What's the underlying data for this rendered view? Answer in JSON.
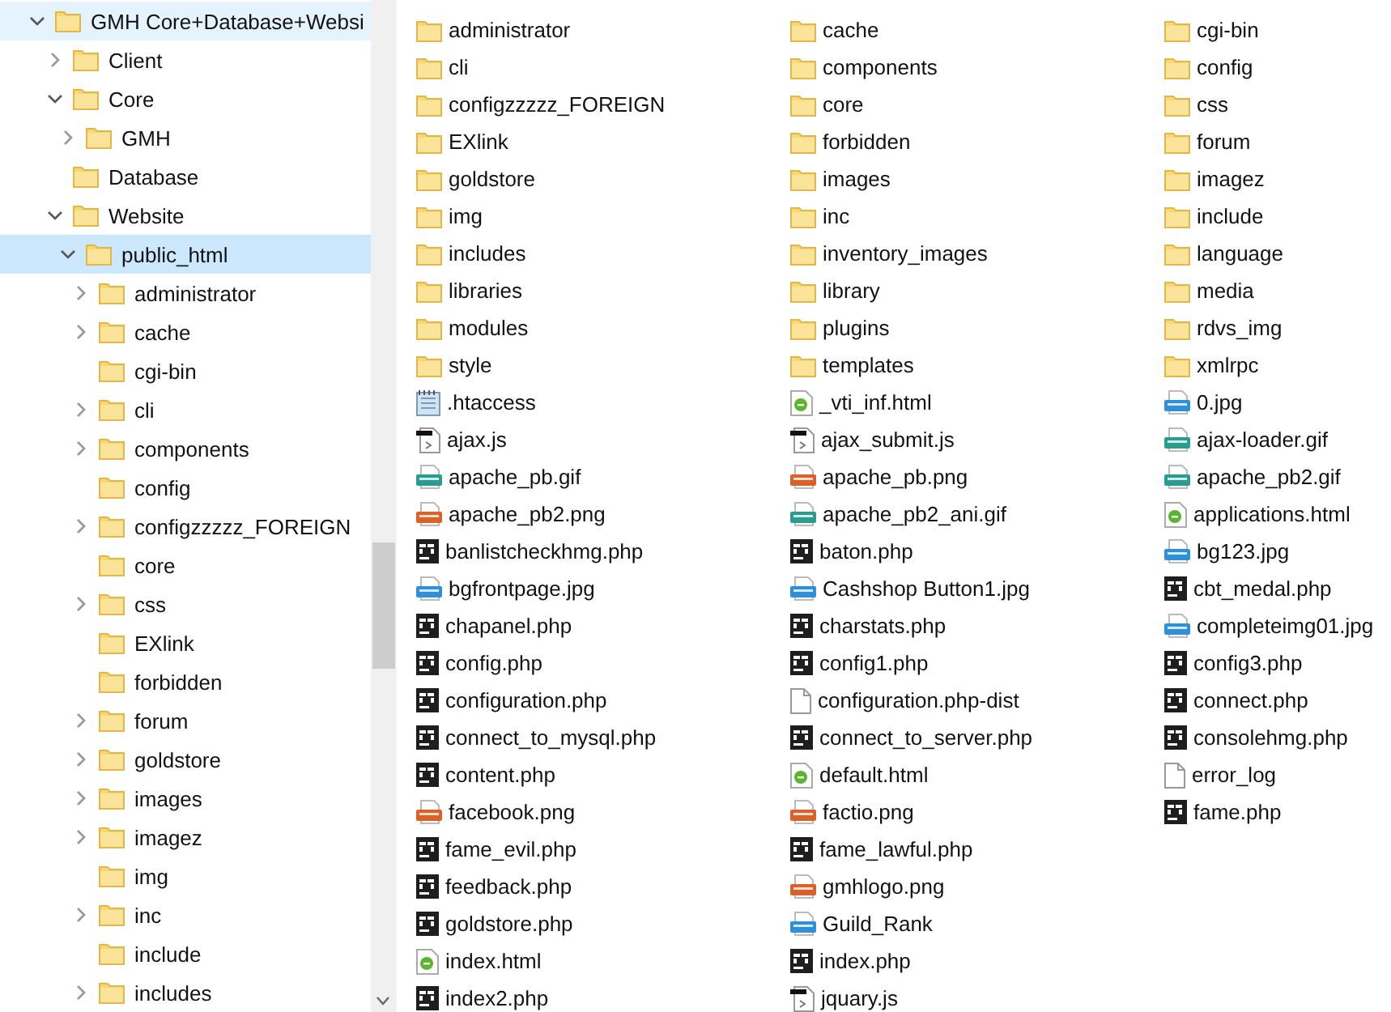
{
  "tree": [
    {
      "name": "GMH Core+Database+Websi",
      "expandable": true,
      "expanded": true,
      "selected": false,
      "hover": true,
      "children": [
        {
          "name": "Client",
          "expandable": true,
          "expanded": false,
          "selected": false,
          "hover": false
        },
        {
          "name": "Core",
          "expandable": true,
          "expanded": true,
          "selected": false,
          "hover": false,
          "children": [
            {
              "name": "GMH",
              "expandable": true,
              "expanded": false,
              "selected": false,
              "hover": false
            }
          ]
        },
        {
          "name": "Database",
          "expandable": false,
          "expanded": false,
          "selected": false,
          "hover": false
        },
        {
          "name": "Website",
          "expandable": true,
          "expanded": true,
          "selected": false,
          "hover": false,
          "children": [
            {
              "name": "public_html",
              "expandable": true,
              "expanded": true,
              "selected": true,
              "hover": false,
              "children": [
                {
                  "name": "administrator",
                  "expandable": true,
                  "expanded": false,
                  "selected": false,
                  "hover": false
                },
                {
                  "name": "cache",
                  "expandable": true,
                  "expanded": false,
                  "selected": false,
                  "hover": false
                },
                {
                  "name": "cgi-bin",
                  "expandable": false,
                  "expanded": false,
                  "selected": false,
                  "hover": false
                },
                {
                  "name": "cli",
                  "expandable": true,
                  "expanded": false,
                  "selected": false,
                  "hover": false
                },
                {
                  "name": "components",
                  "expandable": true,
                  "expanded": false,
                  "selected": false,
                  "hover": false
                },
                {
                  "name": "config",
                  "expandable": false,
                  "expanded": false,
                  "selected": false,
                  "hover": false
                },
                {
                  "name": "configzzzzz_FOREIGN",
                  "expandable": true,
                  "expanded": false,
                  "selected": false,
                  "hover": false
                },
                {
                  "name": "core",
                  "expandable": false,
                  "expanded": false,
                  "selected": false,
                  "hover": false
                },
                {
                  "name": "css",
                  "expandable": true,
                  "expanded": false,
                  "selected": false,
                  "hover": false
                },
                {
                  "name": "EXlink",
                  "expandable": false,
                  "expanded": false,
                  "selected": false,
                  "hover": false
                },
                {
                  "name": "forbidden",
                  "expandable": false,
                  "expanded": false,
                  "selected": false,
                  "hover": false
                },
                {
                  "name": "forum",
                  "expandable": true,
                  "expanded": false,
                  "selected": false,
                  "hover": false
                },
                {
                  "name": "goldstore",
                  "expandable": true,
                  "expanded": false,
                  "selected": false,
                  "hover": false
                },
                {
                  "name": "images",
                  "expandable": true,
                  "expanded": false,
                  "selected": false,
                  "hover": false
                },
                {
                  "name": "imagez",
                  "expandable": true,
                  "expanded": false,
                  "selected": false,
                  "hover": false
                },
                {
                  "name": "img",
                  "expandable": false,
                  "expanded": false,
                  "selected": false,
                  "hover": false
                },
                {
                  "name": "inc",
                  "expandable": true,
                  "expanded": false,
                  "selected": false,
                  "hover": false
                },
                {
                  "name": "include",
                  "expandable": false,
                  "expanded": false,
                  "selected": false,
                  "hover": false
                },
                {
                  "name": "includes",
                  "expandable": true,
                  "expanded": false,
                  "selected": false,
                  "hover": false
                }
              ]
            }
          ]
        }
      ]
    }
  ],
  "files": {
    "columns": [
      [
        {
          "name": "administrator",
          "kind": "folder"
        },
        {
          "name": "cli",
          "kind": "folder"
        },
        {
          "name": "configzzzzz_FOREIGN",
          "kind": "folder"
        },
        {
          "name": "EXlink",
          "kind": "folder"
        },
        {
          "name": "goldstore",
          "kind": "folder"
        },
        {
          "name": "img",
          "kind": "folder"
        },
        {
          "name": "includes",
          "kind": "folder"
        },
        {
          "name": "libraries",
          "kind": "folder"
        },
        {
          "name": "modules",
          "kind": "folder"
        },
        {
          "name": "style",
          "kind": "folder"
        },
        {
          "name": ".htaccess",
          "kind": "text"
        },
        {
          "name": "ajax.js",
          "kind": "js"
        },
        {
          "name": "apache_pb.gif",
          "kind": "gif"
        },
        {
          "name": "apache_pb2.png",
          "kind": "png"
        },
        {
          "name": "banlistcheckhmg.php",
          "kind": "php"
        },
        {
          "name": "bgfrontpage.jpg",
          "kind": "jpg"
        },
        {
          "name": "chapanel.php",
          "kind": "php"
        },
        {
          "name": "config.php",
          "kind": "php"
        },
        {
          "name": "configuration.php",
          "kind": "php"
        },
        {
          "name": "connect_to_mysql.php",
          "kind": "php"
        },
        {
          "name": "content.php",
          "kind": "php"
        },
        {
          "name": "facebook.png",
          "kind": "png"
        },
        {
          "name": "fame_evil.php",
          "kind": "php"
        },
        {
          "name": "feedback.php",
          "kind": "php"
        },
        {
          "name": "goldstore.php",
          "kind": "php"
        },
        {
          "name": "index.html",
          "kind": "html"
        },
        {
          "name": "index2.php",
          "kind": "php"
        }
      ],
      [
        {
          "name": "cache",
          "kind": "folder"
        },
        {
          "name": "components",
          "kind": "folder"
        },
        {
          "name": "core",
          "kind": "folder"
        },
        {
          "name": "forbidden",
          "kind": "folder"
        },
        {
          "name": "images",
          "kind": "folder"
        },
        {
          "name": "inc",
          "kind": "folder"
        },
        {
          "name": "inventory_images",
          "kind": "folder"
        },
        {
          "name": "library",
          "kind": "folder"
        },
        {
          "name": "plugins",
          "kind": "folder"
        },
        {
          "name": "templates",
          "kind": "folder"
        },
        {
          "name": "_vti_inf.html",
          "kind": "html"
        },
        {
          "name": "ajax_submit.js",
          "kind": "js"
        },
        {
          "name": "apache_pb.png",
          "kind": "png"
        },
        {
          "name": "apache_pb2_ani.gif",
          "kind": "gif"
        },
        {
          "name": "baton.php",
          "kind": "php"
        },
        {
          "name": "Cashshop Button1.jpg",
          "kind": "jpg"
        },
        {
          "name": "charstats.php",
          "kind": "php"
        },
        {
          "name": "config1.php",
          "kind": "php"
        },
        {
          "name": "configuration.php-dist",
          "kind": "file"
        },
        {
          "name": "connect_to_server.php",
          "kind": "php"
        },
        {
          "name": "default.html",
          "kind": "html"
        },
        {
          "name": "factio.png",
          "kind": "png"
        },
        {
          "name": "fame_lawful.php",
          "kind": "php"
        },
        {
          "name": "gmhlogo.png",
          "kind": "png"
        },
        {
          "name": "Guild_Rank",
          "kind": "jpg"
        },
        {
          "name": "index.php",
          "kind": "php"
        },
        {
          "name": "jquary.js",
          "kind": "js"
        }
      ],
      [
        {
          "name": "cgi-bin",
          "kind": "folder"
        },
        {
          "name": "config",
          "kind": "folder"
        },
        {
          "name": "css",
          "kind": "folder"
        },
        {
          "name": "forum",
          "kind": "folder"
        },
        {
          "name": "imagez",
          "kind": "folder"
        },
        {
          "name": "include",
          "kind": "folder"
        },
        {
          "name": "language",
          "kind": "folder"
        },
        {
          "name": "media",
          "kind": "folder"
        },
        {
          "name": "rdvs_img",
          "kind": "folder"
        },
        {
          "name": "xmlrpc",
          "kind": "folder"
        },
        {
          "name": "0.jpg",
          "kind": "jpg"
        },
        {
          "name": "ajax-loader.gif",
          "kind": "gif"
        },
        {
          "name": "apache_pb2.gif",
          "kind": "gif"
        },
        {
          "name": "applications.html",
          "kind": "html"
        },
        {
          "name": "bg123.jpg",
          "kind": "jpg"
        },
        {
          "name": "cbt_medal.php",
          "kind": "php"
        },
        {
          "name": "completeimg01.jpg",
          "kind": "jpg"
        },
        {
          "name": "config3.php",
          "kind": "php"
        },
        {
          "name": "connect.php",
          "kind": "php"
        },
        {
          "name": "consolehmg.php",
          "kind": "php"
        },
        {
          "name": "error_log",
          "kind": "file"
        },
        {
          "name": "fame.php",
          "kind": "php"
        }
      ]
    ]
  }
}
